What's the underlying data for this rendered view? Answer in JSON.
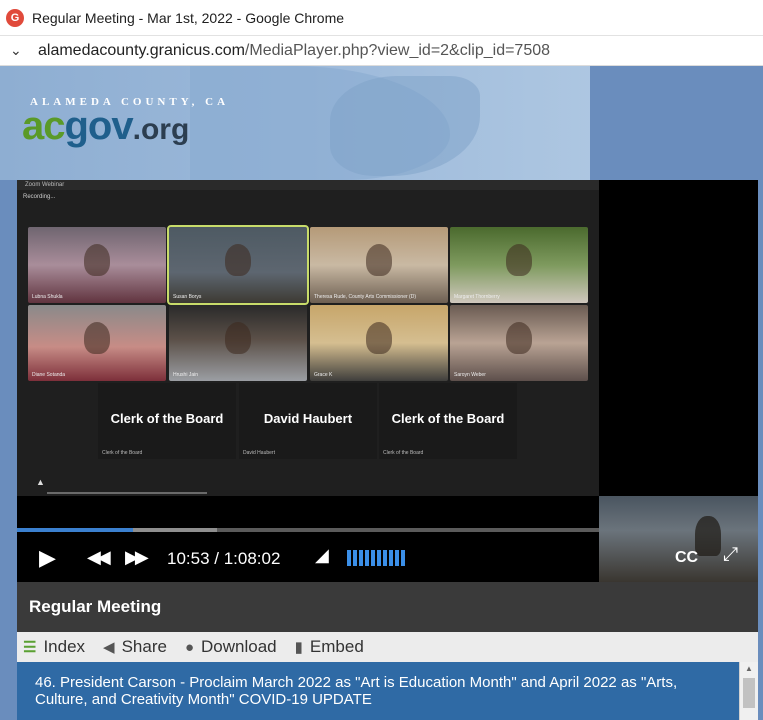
{
  "window": {
    "title": "Regular Meeting - Mar 1st, 2022 - Google Chrome",
    "app_icon": "G"
  },
  "address": {
    "host": "alamedacounty.granicus.com",
    "path": "/MediaPlayer.php?view_id=2&clip_id=7508"
  },
  "banner": {
    "county": "ALAMEDA COUNTY, CA",
    "logo_ac": "ac",
    "logo_gov": "gov",
    "logo_org": ".org"
  },
  "zoom": {
    "window_title": "Zoom Webinar",
    "recording": "Recording...",
    "participants": [
      {
        "name": "Lubna Shukla"
      },
      {
        "name": "Susan Borys"
      },
      {
        "name": "Theresa Rude, County Arts Commissioner (D)"
      },
      {
        "name": "Margaret Thornberry"
      },
      {
        "name": "Diane Sotanda"
      },
      {
        "name": "Hrushi Jain"
      },
      {
        "name": "Grace K"
      },
      {
        "name": "Saroyn Weber"
      }
    ],
    "named_tiles": [
      {
        "label": "Clerk of the Board",
        "name": "Clerk of the Board"
      },
      {
        "label": "David Haubert",
        "name": "David Haubert"
      },
      {
        "label": "Clerk of the Board",
        "name": "Clerk of the Board"
      }
    ]
  },
  "player": {
    "progress": 0.2,
    "time": "10:53 / 1:08:02",
    "volume_bars": 10,
    "cc": "CC",
    "colors": {
      "accent": "#3b80cf",
      "volume": "#3b8fe8"
    }
  },
  "meeting": {
    "title": "Regular Meeting"
  },
  "tabs": {
    "index": "Index",
    "share": "Share",
    "download": "Download",
    "embed": "Embed"
  },
  "agenda": {
    "item": "46. President Carson - Proclaim March 2022 as \"Art is Education Month\" and April 2022 as \"Arts, Culture, and Creativity Month\"  COVID-19 UPDATE"
  }
}
